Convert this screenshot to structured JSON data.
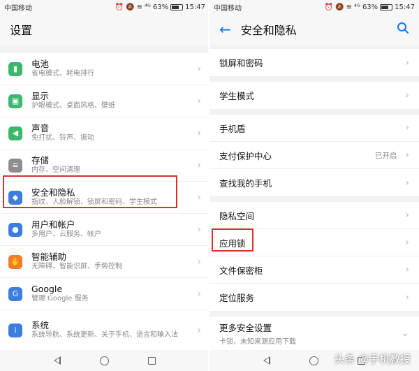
{
  "status": {
    "carrier": "中国移动",
    "signal_icons": "⁴ᴳ",
    "battery_pct": "63%",
    "time": "15:47",
    "battery_level": 0.63
  },
  "left": {
    "title": "设置",
    "items": [
      {
        "title": "电池",
        "sub": "省电模式、耗电排行",
        "color": "#3bb86b",
        "glyph": "▮",
        "icon": "battery-icon"
      },
      {
        "title": "显示",
        "sub": "护眼模式、桌面风格、壁纸",
        "color": "#3bb86b",
        "glyph": "▣",
        "icon": "display-icon"
      },
      {
        "title": "声音",
        "sub": "免打扰、铃声、振动",
        "color": "#3bb86b",
        "glyph": "◀",
        "icon": "sound-icon"
      },
      {
        "title": "存储",
        "sub": "内存、空间清理",
        "color": "#8e8e8e",
        "glyph": "≡",
        "icon": "storage-icon"
      },
      {
        "title": "安全和隐私",
        "sub": "指纹、人脸解锁、锁屏和密码、学生模式",
        "color": "#3c7ee0",
        "glyph": "◆",
        "icon": "shield-icon"
      },
      {
        "title": "用户和帐户",
        "sub": "多用户、云服务、帐户",
        "color": "#3c7ee0",
        "glyph": "●",
        "icon": "user-icon"
      },
      {
        "title": "智能辅助",
        "sub": "无障碍、智能识屏、手势控制",
        "color": "#f07d28",
        "glyph": "✋",
        "icon": "hand-icon"
      },
      {
        "title": "Google",
        "sub": "管理 Google 服务",
        "color": "#3c7ee0",
        "glyph": "G",
        "icon": "google-icon"
      },
      {
        "title": "系统",
        "sub": "系统导航、系统更新、关于手机、语言和输入法",
        "color": "#3c7ee0",
        "glyph": "i",
        "icon": "system-info-icon"
      }
    ]
  },
  "right": {
    "title": "安全和隐私",
    "groups": [
      [
        {
          "label": "锁屏和密码"
        }
      ],
      [
        {
          "label": "学生模式"
        }
      ],
      [
        {
          "label": "手机盾"
        },
        {
          "label": "支付保护中心",
          "status": "已开启"
        },
        {
          "label": "查找我的手机"
        }
      ],
      [
        {
          "label": "隐私空间"
        },
        {
          "label": "应用锁"
        },
        {
          "label": "文件保密柜"
        },
        {
          "label": "定位服务"
        }
      ],
      [
        {
          "label": "更多安全设置",
          "sub": "卡锁、未知来源应用下载"
        }
      ]
    ]
  },
  "watermark": "头条 @手机教授",
  "colors": {
    "accent": "#1a73e8",
    "highlight": "#d9302c"
  }
}
